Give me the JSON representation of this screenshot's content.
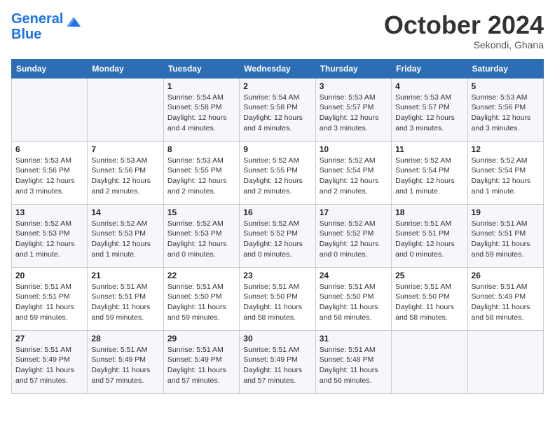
{
  "logo": {
    "line1": "General",
    "line2": "Blue"
  },
  "title": "October 2024",
  "location": "Sekondi, Ghana",
  "days_header": [
    "Sunday",
    "Monday",
    "Tuesday",
    "Wednesday",
    "Thursday",
    "Friday",
    "Saturday"
  ],
  "weeks": [
    [
      {
        "day": "",
        "sunrise": "",
        "sunset": "",
        "daylight": ""
      },
      {
        "day": "",
        "sunrise": "",
        "sunset": "",
        "daylight": ""
      },
      {
        "day": "1",
        "sunrise": "Sunrise: 5:54 AM",
        "sunset": "Sunset: 5:58 PM",
        "daylight": "Daylight: 12 hours and 4 minutes."
      },
      {
        "day": "2",
        "sunrise": "Sunrise: 5:54 AM",
        "sunset": "Sunset: 5:58 PM",
        "daylight": "Daylight: 12 hours and 4 minutes."
      },
      {
        "day": "3",
        "sunrise": "Sunrise: 5:53 AM",
        "sunset": "Sunset: 5:57 PM",
        "daylight": "Daylight: 12 hours and 3 minutes."
      },
      {
        "day": "4",
        "sunrise": "Sunrise: 5:53 AM",
        "sunset": "Sunset: 5:57 PM",
        "daylight": "Daylight: 12 hours and 3 minutes."
      },
      {
        "day": "5",
        "sunrise": "Sunrise: 5:53 AM",
        "sunset": "Sunset: 5:56 PM",
        "daylight": "Daylight: 12 hours and 3 minutes."
      }
    ],
    [
      {
        "day": "6",
        "sunrise": "Sunrise: 5:53 AM",
        "sunset": "Sunset: 5:56 PM",
        "daylight": "Daylight: 12 hours and 3 minutes."
      },
      {
        "day": "7",
        "sunrise": "Sunrise: 5:53 AM",
        "sunset": "Sunset: 5:56 PM",
        "daylight": "Daylight: 12 hours and 2 minutes."
      },
      {
        "day": "8",
        "sunrise": "Sunrise: 5:53 AM",
        "sunset": "Sunset: 5:55 PM",
        "daylight": "Daylight: 12 hours and 2 minutes."
      },
      {
        "day": "9",
        "sunrise": "Sunrise: 5:52 AM",
        "sunset": "Sunset: 5:55 PM",
        "daylight": "Daylight: 12 hours and 2 minutes."
      },
      {
        "day": "10",
        "sunrise": "Sunrise: 5:52 AM",
        "sunset": "Sunset: 5:54 PM",
        "daylight": "Daylight: 12 hours and 2 minutes."
      },
      {
        "day": "11",
        "sunrise": "Sunrise: 5:52 AM",
        "sunset": "Sunset: 5:54 PM",
        "daylight": "Daylight: 12 hours and 1 minute."
      },
      {
        "day": "12",
        "sunrise": "Sunrise: 5:52 AM",
        "sunset": "Sunset: 5:54 PM",
        "daylight": "Daylight: 12 hours and 1 minute."
      }
    ],
    [
      {
        "day": "13",
        "sunrise": "Sunrise: 5:52 AM",
        "sunset": "Sunset: 5:53 PM",
        "daylight": "Daylight: 12 hours and 1 minute."
      },
      {
        "day": "14",
        "sunrise": "Sunrise: 5:52 AM",
        "sunset": "Sunset: 5:53 PM",
        "daylight": "Daylight: 12 hours and 1 minute."
      },
      {
        "day": "15",
        "sunrise": "Sunrise: 5:52 AM",
        "sunset": "Sunset: 5:53 PM",
        "daylight": "Daylight: 12 hours and 0 minutes."
      },
      {
        "day": "16",
        "sunrise": "Sunrise: 5:52 AM",
        "sunset": "Sunset: 5:52 PM",
        "daylight": "Daylight: 12 hours and 0 minutes."
      },
      {
        "day": "17",
        "sunrise": "Sunrise: 5:52 AM",
        "sunset": "Sunset: 5:52 PM",
        "daylight": "Daylight: 12 hours and 0 minutes."
      },
      {
        "day": "18",
        "sunrise": "Sunrise: 5:51 AM",
        "sunset": "Sunset: 5:51 PM",
        "daylight": "Daylight: 12 hours and 0 minutes."
      },
      {
        "day": "19",
        "sunrise": "Sunrise: 5:51 AM",
        "sunset": "Sunset: 5:51 PM",
        "daylight": "Daylight: 11 hours and 59 minutes."
      }
    ],
    [
      {
        "day": "20",
        "sunrise": "Sunrise: 5:51 AM",
        "sunset": "Sunset: 5:51 PM",
        "daylight": "Daylight: 11 hours and 59 minutes."
      },
      {
        "day": "21",
        "sunrise": "Sunrise: 5:51 AM",
        "sunset": "Sunset: 5:51 PM",
        "daylight": "Daylight: 11 hours and 59 minutes."
      },
      {
        "day": "22",
        "sunrise": "Sunrise: 5:51 AM",
        "sunset": "Sunset: 5:50 PM",
        "daylight": "Daylight: 11 hours and 59 minutes."
      },
      {
        "day": "23",
        "sunrise": "Sunrise: 5:51 AM",
        "sunset": "Sunset: 5:50 PM",
        "daylight": "Daylight: 11 hours and 58 minutes."
      },
      {
        "day": "24",
        "sunrise": "Sunrise: 5:51 AM",
        "sunset": "Sunset: 5:50 PM",
        "daylight": "Daylight: 11 hours and 58 minutes."
      },
      {
        "day": "25",
        "sunrise": "Sunrise: 5:51 AM",
        "sunset": "Sunset: 5:50 PM",
        "daylight": "Daylight: 11 hours and 58 minutes."
      },
      {
        "day": "26",
        "sunrise": "Sunrise: 5:51 AM",
        "sunset": "Sunset: 5:49 PM",
        "daylight": "Daylight: 11 hours and 58 minutes."
      }
    ],
    [
      {
        "day": "27",
        "sunrise": "Sunrise: 5:51 AM",
        "sunset": "Sunset: 5:49 PM",
        "daylight": "Daylight: 11 hours and 57 minutes."
      },
      {
        "day": "28",
        "sunrise": "Sunrise: 5:51 AM",
        "sunset": "Sunset: 5:49 PM",
        "daylight": "Daylight: 11 hours and 57 minutes."
      },
      {
        "day": "29",
        "sunrise": "Sunrise: 5:51 AM",
        "sunset": "Sunset: 5:49 PM",
        "daylight": "Daylight: 11 hours and 57 minutes."
      },
      {
        "day": "30",
        "sunrise": "Sunrise: 5:51 AM",
        "sunset": "Sunset: 5:49 PM",
        "daylight": "Daylight: 11 hours and 57 minutes."
      },
      {
        "day": "31",
        "sunrise": "Sunrise: 5:51 AM",
        "sunset": "Sunset: 5:48 PM",
        "daylight": "Daylight: 11 hours and 56 minutes."
      },
      {
        "day": "",
        "sunrise": "",
        "sunset": "",
        "daylight": ""
      },
      {
        "day": "",
        "sunrise": "",
        "sunset": "",
        "daylight": ""
      }
    ]
  ]
}
